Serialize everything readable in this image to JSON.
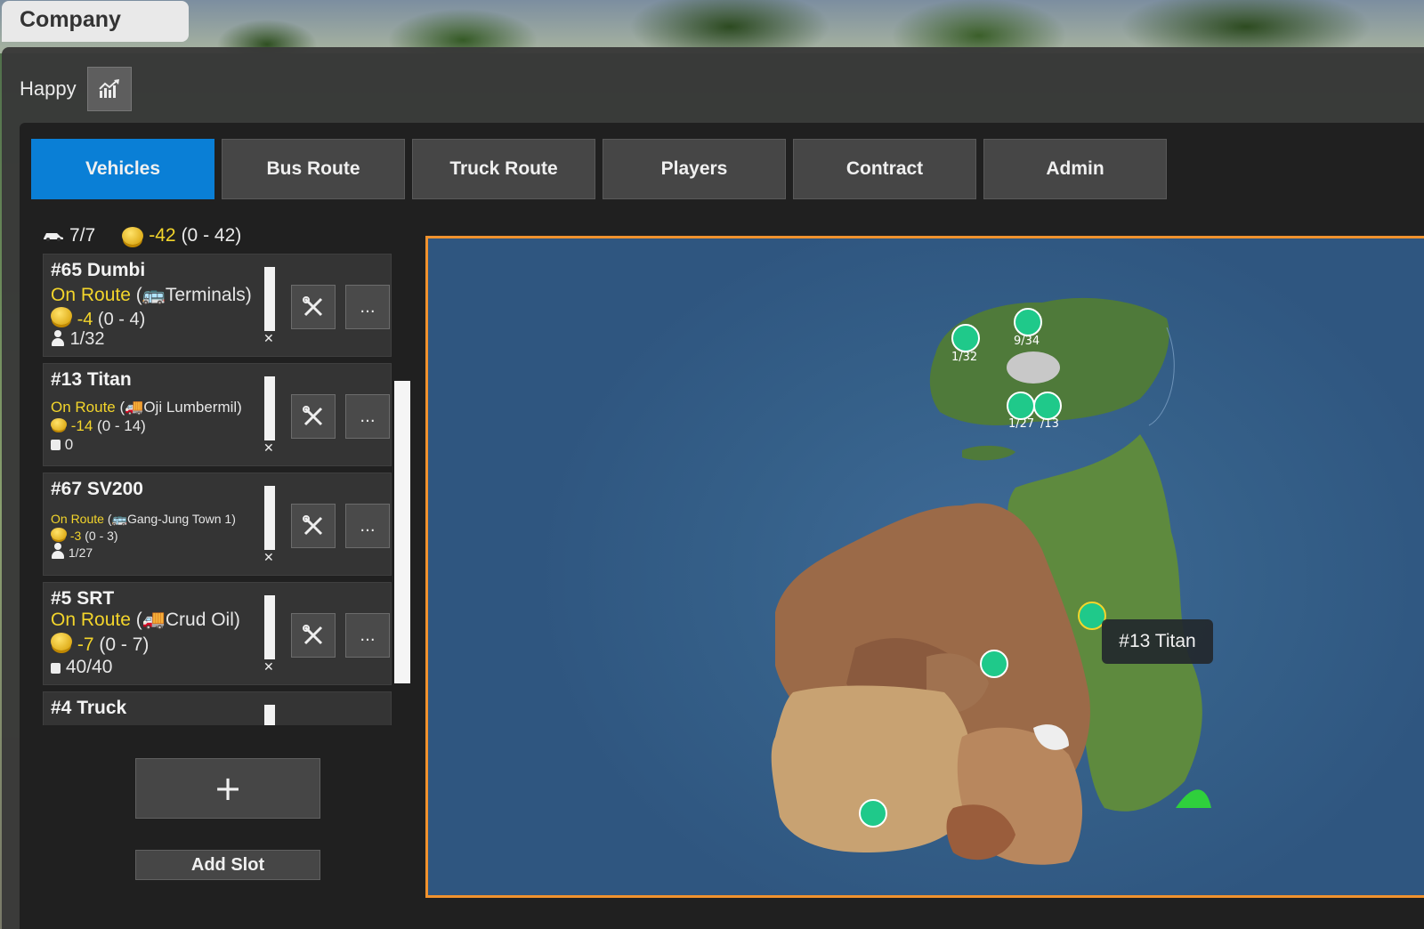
{
  "window": {
    "title": "Company"
  },
  "header": {
    "mood_label": "Happy",
    "stats_icon": "chart-trend-icon"
  },
  "tabs": [
    {
      "label": "Vehicles",
      "active": true
    },
    {
      "label": "Bus Route",
      "active": false
    },
    {
      "label": "Truck Route",
      "active": false
    },
    {
      "label": "Players",
      "active": false
    },
    {
      "label": "Contract",
      "active": false
    },
    {
      "label": "Admin",
      "active": false
    }
  ],
  "summary": {
    "vehicle_count": "7/7",
    "money": "-42",
    "money_range": "(0 - 42)"
  },
  "vehicles": [
    {
      "name": "#65 Dumbi",
      "status": "On Route",
      "route_prefix": " (",
      "destination": "Terminals)",
      "money": "-4",
      "money_range": "(0 - 4)",
      "cargo": "1/32",
      "cargo_icon": "person-icon"
    },
    {
      "name": "#13 Titan",
      "status": "On Route",
      "route_prefix": " (",
      "destination": "Oji Lumbermil)",
      "money": "-14",
      "money_range": "(0 - 14)",
      "cargo": "0",
      "cargo_icon": "box-icon"
    },
    {
      "name": "#67 SV200",
      "status": "On Route",
      "route_prefix": " (",
      "destination": "Gang-Jung Town 1)",
      "money": "-3",
      "money_range": "(0 - 3)",
      "cargo": "1/27",
      "cargo_icon": "person-icon"
    },
    {
      "name": "#5 SRT",
      "status": "On Route",
      "route_prefix": " (",
      "destination": "Crud Oil)",
      "money": "-7",
      "money_range": "(0 - 7)",
      "cargo": "40/40",
      "cargo_icon": "box-icon"
    },
    {
      "name": "#4 Truck"
    }
  ],
  "buttons": {
    "add": "+",
    "add_slot": "Add Slot",
    "more": "..."
  },
  "map": {
    "markers": [
      {
        "label": "1/32",
        "type": "bus"
      },
      {
        "label": "9/34",
        "type": "bus"
      },
      {
        "label": "1/27",
        "type": "bus"
      },
      {
        "label": "/13",
        "type": "bus"
      },
      {
        "label": "",
        "type": "truck"
      },
      {
        "label": "",
        "type": "truck"
      },
      {
        "label": "",
        "type": "truck"
      }
    ],
    "tooltip": "#13 Titan"
  },
  "colors": {
    "accent": "#0a7fd6",
    "status": "#f3d52b",
    "map_border": "#f0922e",
    "marker": "#1fc98a"
  }
}
